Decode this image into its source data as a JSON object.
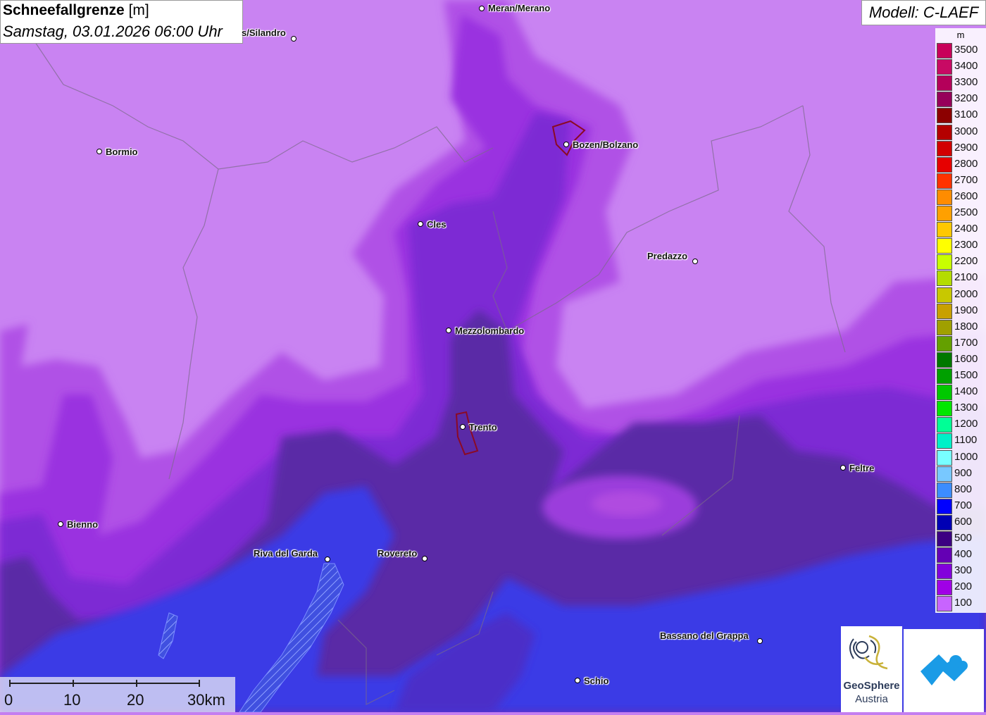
{
  "header": {
    "title": "Schneefallgrenze",
    "unit": "[m]",
    "datetime": "Samstag, 03.01.2026 06:00 Uhr"
  },
  "model": "Modell: C-LAEF",
  "legend": {
    "unit": "m",
    "items": [
      {
        "label": "3500",
        "color": "#c8005a"
      },
      {
        "label": "3400",
        "color": "#c80a64"
      },
      {
        "label": "3300",
        "color": "#b4005a"
      },
      {
        "label": "3200",
        "color": "#96005a"
      },
      {
        "label": "3100",
        "color": "#8c0000"
      },
      {
        "label": "3000",
        "color": "#b40000"
      },
      {
        "label": "2900",
        "color": "#d20000"
      },
      {
        "label": "2800",
        "color": "#e60000"
      },
      {
        "label": "2700",
        "color": "#ff3200"
      },
      {
        "label": "2600",
        "color": "#ff8c00"
      },
      {
        "label": "2500",
        "color": "#ffa000"
      },
      {
        "label": "2400",
        "color": "#ffc800"
      },
      {
        "label": "2300",
        "color": "#ffff00"
      },
      {
        "label": "2200",
        "color": "#c8ff00"
      },
      {
        "label": "2100",
        "color": "#b4dc00"
      },
      {
        "label": "2000",
        "color": "#c8c800"
      },
      {
        "label": "1900",
        "color": "#c8a000"
      },
      {
        "label": "1800",
        "color": "#a0a000"
      },
      {
        "label": "1700",
        "color": "#64a000"
      },
      {
        "label": "1600",
        "color": "#007800"
      },
      {
        "label": "1500",
        "color": "#00a000"
      },
      {
        "label": "1400",
        "color": "#00c800"
      },
      {
        "label": "1300",
        "color": "#00e600"
      },
      {
        "label": "1200",
        "color": "#00ff96"
      },
      {
        "label": "1100",
        "color": "#00f0c8"
      },
      {
        "label": "1000",
        "color": "#78ffff"
      },
      {
        "label": "900",
        "color": "#78c8ff"
      },
      {
        "label": "800",
        "color": "#3c8cff"
      },
      {
        "label": "700",
        "color": "#0000ff"
      },
      {
        "label": "600",
        "color": "#0000b4"
      },
      {
        "label": "500",
        "color": "#3c0082"
      },
      {
        "label": "400",
        "color": "#6400b4"
      },
      {
        "label": "300",
        "color": "#8200dc"
      },
      {
        "label": "200",
        "color": "#a000e6"
      },
      {
        "label": "100",
        "color": "#c864ff"
      }
    ]
  },
  "cities": [
    {
      "name": "Meran/Merano",
      "id": "city-meran"
    },
    {
      "name": "s/Silandro",
      "id": "city-silandro"
    },
    {
      "name": "Bormio",
      "id": "city-bormio"
    },
    {
      "name": "Bozen/Bolzano",
      "id": "city-bolzano"
    },
    {
      "name": "Cles",
      "id": "city-cles"
    },
    {
      "name": "Predazzo",
      "id": "city-predazzo"
    },
    {
      "name": "Mezzolombardo",
      "id": "city-mezzolombardo"
    },
    {
      "name": "Trento",
      "id": "city-trento"
    },
    {
      "name": "Feltre",
      "id": "city-feltre"
    },
    {
      "name": "Bienno",
      "id": "city-bienno"
    },
    {
      "name": "Riva del Garda",
      "id": "city-riva"
    },
    {
      "name": "Rovereto",
      "id": "city-rovereto"
    },
    {
      "name": "Bassano del Grappa",
      "id": "city-bassano"
    },
    {
      "name": "Schio",
      "id": "city-schio"
    }
  ],
  "scale": {
    "labels": [
      "0",
      "10",
      "20",
      "30km"
    ]
  },
  "logos": {
    "geosphere_name": "GeoSphere",
    "geosphere_sub": "Austria"
  }
}
